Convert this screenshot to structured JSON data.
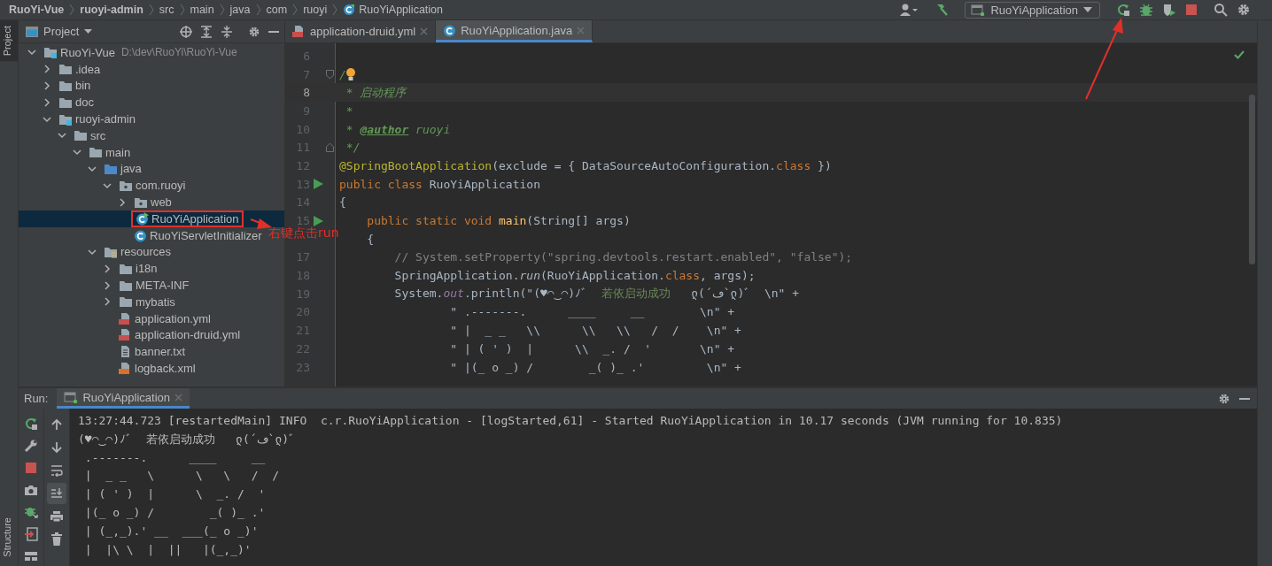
{
  "breadcrumbs": [
    {
      "label": "RuoYi-Vue",
      "kind": "module"
    },
    {
      "label": "ruoyi-admin",
      "kind": "module"
    },
    {
      "label": "src",
      "kind": "dir"
    },
    {
      "label": "main",
      "kind": "dir"
    },
    {
      "label": "java",
      "kind": "dir"
    },
    {
      "label": "com",
      "kind": "dir"
    },
    {
      "label": "ruoyi",
      "kind": "dir"
    },
    {
      "label": "RuoYiApplication",
      "kind": "class"
    }
  ],
  "toolbar": [
    {
      "kind": "user"
    },
    {
      "kind": "build"
    },
    {
      "kind": "run-config",
      "label": "RuoYiApplication"
    },
    {
      "kind": "rerun"
    },
    {
      "kind": "debug"
    },
    {
      "kind": "coverage"
    },
    {
      "kind": "stop"
    },
    {
      "kind": "search"
    },
    {
      "kind": "settings"
    }
  ],
  "side_tabs": [
    {
      "label": "Project",
      "selected": true
    },
    {
      "label": "Structure",
      "selected": false
    }
  ],
  "project_panel": {
    "title": "Project"
  },
  "tree": [
    {
      "name": "RuoYi-Vue",
      "kind": "module",
      "path": "D:\\dev\\RuoYi\\RuoYi-Vue",
      "expanded": true,
      "selected": false,
      "children": [
        {
          "name": ".idea",
          "kind": "folder",
          "expanded": false,
          "selected": false
        },
        {
          "name": "bin",
          "kind": "folder",
          "expanded": false,
          "selected": false
        },
        {
          "name": "doc",
          "kind": "folder",
          "expanded": false,
          "selected": false
        },
        {
          "name": "ruoyi-admin",
          "kind": "module",
          "expanded": true,
          "selected": false,
          "children": [
            {
              "name": "src",
              "kind": "folder",
              "expanded": true,
              "selected": false,
              "children": [
                {
                  "name": "main",
                  "kind": "folder",
                  "expanded": true,
                  "selected": false,
                  "children": [
                    {
                      "name": "java",
                      "kind": "source",
                      "expanded": true,
                      "selected": false,
                      "children": [
                        {
                          "name": "com.ruoyi",
                          "kind": "package",
                          "expanded": true,
                          "selected": false,
                          "children": [
                            {
                              "name": "web",
                              "kind": "package",
                              "expanded": false,
                              "selected": false
                            },
                            {
                              "name": "RuoYiApplication",
                              "kind": "class-run",
                              "selected": true,
                              "marked": true
                            },
                            {
                              "name": "RuoYiServletInitializer",
                              "kind": "class",
                              "selected": false
                            }
                          ]
                        }
                      ]
                    },
                    {
                      "name": "resources",
                      "kind": "resources",
                      "expanded": true,
                      "selected": false,
                      "children": [
                        {
                          "name": "i18n",
                          "kind": "folder",
                          "expanded": false,
                          "selected": false
                        },
                        {
                          "name": "META-INF",
                          "kind": "folder",
                          "expanded": false,
                          "selected": false
                        },
                        {
                          "name": "mybatis",
                          "kind": "folder",
                          "expanded": false,
                          "selected": false
                        },
                        {
                          "name": "application.yml",
                          "kind": "yml",
                          "selected": false
                        },
                        {
                          "name": "application-druid.yml",
                          "kind": "yml",
                          "selected": false
                        },
                        {
                          "name": "banner.txt",
                          "kind": "txt",
                          "selected": false
                        },
                        {
                          "name": "logback.xml",
                          "kind": "xml",
                          "selected": false
                        }
                      ]
                    }
                  ]
                }
              ]
            }
          ]
        }
      ]
    }
  ],
  "editor_tabs": [
    {
      "label": "application-druid.yml",
      "kind": "yml",
      "selected": false
    },
    {
      "label": "RuoYiApplication.java",
      "kind": "class",
      "selected": true
    }
  ],
  "code": [
    {
      "num": "6",
      "current": false
    },
    {
      "num": "7",
      "current": false,
      "fold_start": true,
      "hint_icon": true,
      "tokens": [
        {
          "t": "/",
          "kind": "doc"
        }
      ]
    },
    {
      "num": "8",
      "current": true,
      "tokens": [
        {
          "t": " * 启动程序",
          "kind": "doc"
        }
      ]
    },
    {
      "num": "9",
      "current": false,
      "tokens": [
        {
          "t": " *",
          "kind": "doc"
        }
      ]
    },
    {
      "num": "10",
      "current": false,
      "tokens": [
        {
          "t": " * ",
          "kind": "doc"
        },
        {
          "t": "@author",
          "kind": "doctag"
        },
        {
          "t": " ruoyi",
          "kind": "doc"
        }
      ]
    },
    {
      "num": "11",
      "current": false,
      "fold_end": true,
      "tokens": [
        {
          "t": " */",
          "kind": "doc"
        }
      ]
    },
    {
      "num": "12",
      "current": false,
      "tokens": [
        {
          "t": "@SpringBootApplication",
          "kind": "annotation"
        },
        {
          "t": "(exclude = { DataSourceAutoConfiguration.",
          "kind": "plain"
        },
        {
          "t": "class",
          "kind": "keyword"
        },
        {
          "t": " })",
          "kind": "plain"
        }
      ]
    },
    {
      "num": "13",
      "current": false,
      "run": true,
      "tokens": [
        {
          "t": "public class ",
          "kind": "keyword"
        },
        {
          "t": "RuoYiApplication",
          "kind": "plain"
        }
      ]
    },
    {
      "num": "14",
      "current": false,
      "tokens": [
        {
          "t": "{",
          "kind": "plain"
        }
      ]
    },
    {
      "num": "15",
      "current": false,
      "run": true,
      "tokens": [
        {
          "t": "    public static void ",
          "kind": "keyword"
        },
        {
          "t": "main",
          "kind": "method"
        },
        {
          "t": "(String[] args)",
          "kind": "plain"
        }
      ]
    },
    {
      "current": false,
      "tokens": [
        {
          "t": "    {",
          "kind": "plain"
        }
      ]
    },
    {
      "num": "17",
      "current": false,
      "tokens": [
        {
          "t": "        // System.setProperty(\"spring.devtools.restart.enabled\", \"false\");",
          "kind": "comment"
        }
      ]
    },
    {
      "num": "18",
      "current": false,
      "tokens": [
        {
          "t": "        SpringApplication.",
          "kind": "plain"
        },
        {
          "t": "run",
          "kind": "call"
        },
        {
          "t": "(RuoYiApplication.",
          "kind": "plain"
        },
        {
          "t": "class",
          "kind": "keyword"
        },
        {
          "t": ", args);",
          "kind": "plain"
        }
      ]
    },
    {
      "num": "19",
      "current": false,
      "tokens": [
        {
          "t": "        System.",
          "kind": "plain"
        },
        {
          "t": "out",
          "kind": "field"
        },
        {
          "t": ".println(\"(♥◠‿◠)ﾉﾞ  ",
          "kind": "plain"
        },
        {
          "t": "若依启动成功",
          "kind": "string"
        },
        {
          "t": "   ლ(´ڡ`ლ)ﾞ  \\n\" +",
          "kind": "plain"
        }
      ]
    },
    {
      "num": "20",
      "current": false,
      "tokens": [
        {
          "t": "                \" .-------.      ____     __        \\n\" +",
          "kind": "plain"
        }
      ]
    },
    {
      "num": "21",
      "current": false,
      "tokens": [
        {
          "t": "                \" |  _ _   \\\\      \\\\   \\\\   /  /    \\n\" +",
          "kind": "plain"
        }
      ]
    },
    {
      "num": "22",
      "current": false,
      "tokens": [
        {
          "t": "                \" | ( ' )  |      \\\\  _. /  '       \\n\" +",
          "kind": "plain"
        }
      ]
    },
    {
      "num": "23",
      "current": false,
      "tokens": [
        {
          "t": "                \" |(_ o _) /        _( )_ .'         \\n\" +",
          "kind": "plain"
        }
      ]
    }
  ],
  "annotation": {
    "text": "右键点击run"
  },
  "run_panel": {
    "label": "Run:",
    "tab": "RuoYiApplication"
  },
  "run_tools": [
    {
      "kind": "rerun",
      "selected": false
    },
    {
      "kind": "wrench",
      "selected": false
    },
    {
      "kind": "stop",
      "selected": false
    },
    {
      "kind": "camera",
      "selected": false
    },
    {
      "kind": "debug",
      "selected": false
    },
    {
      "kind": "exit",
      "selected": false
    },
    {
      "kind": "layout",
      "selected": false
    }
  ],
  "console_tools": [
    {
      "kind": "up",
      "selected": false
    },
    {
      "kind": "down",
      "selected": false
    },
    {
      "kind": "wrap",
      "selected": false
    },
    {
      "kind": "scroll-end",
      "selected": true
    },
    {
      "kind": "print",
      "selected": false
    },
    {
      "kind": "trash",
      "selected": false
    }
  ],
  "console": [
    "13:27:44.723 [restartedMain] INFO  c.r.RuoYiApplication - [logStarted,61] - Started RuoYiApplication in 10.17 seconds (JVM running for 10.835)",
    "(♥◠‿◠)ﾉﾞ  若依启动成功   ლ(´ڡ`ლ)ﾞ",
    " .-------.      ____     __",
    " |  _ _   \\      \\   \\   /  /",
    " | ( ' )  |      \\  _. /  '",
    " |(_ o _) /        _( )_ .'",
    " | (_,_).' __  ___(_ o _)'",
    " |  |\\ \\  |  ||   |(_,_)'"
  ]
}
